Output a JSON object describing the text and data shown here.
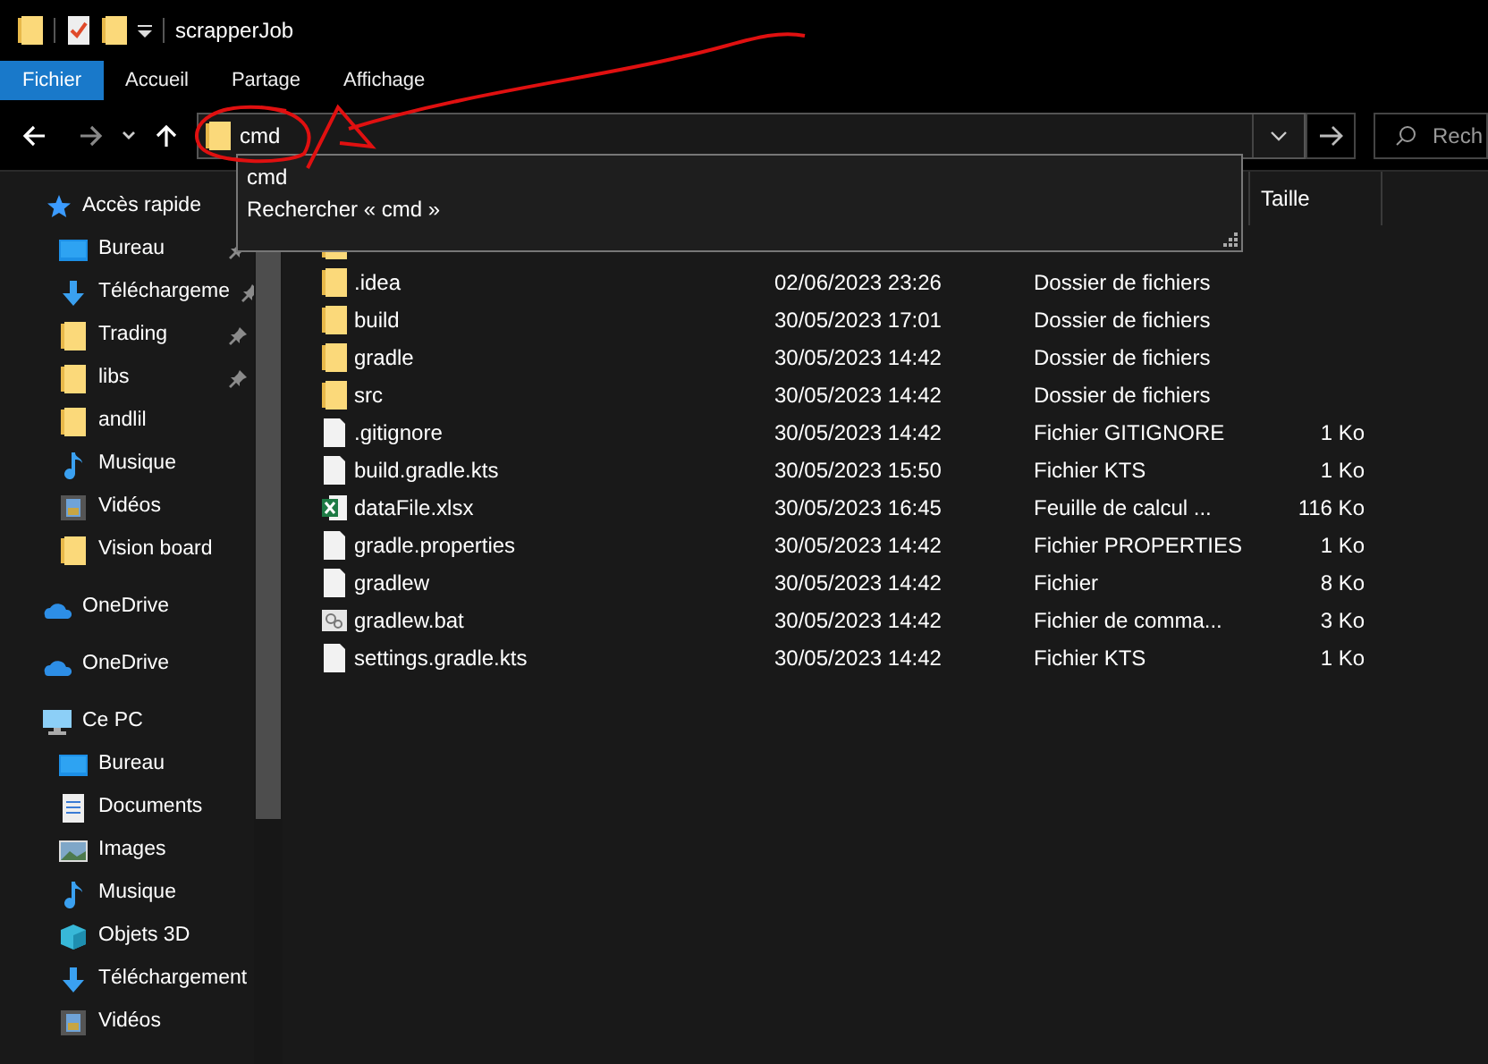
{
  "window": {
    "title": "scrapperJob"
  },
  "ribbon_tabs": [
    {
      "label": "Fichier",
      "selected": true
    },
    {
      "label": "Accueil",
      "selected": false
    },
    {
      "label": "Partage",
      "selected": false
    },
    {
      "label": "Affichage",
      "selected": false
    }
  ],
  "address": {
    "value": "cmd"
  },
  "search": {
    "placeholder": "Rech"
  },
  "suggestions": [
    "cmd",
    "Rechercher « cmd »"
  ],
  "sidebar": [
    {
      "kind": "star",
      "label": "Accès rapide",
      "children": [
        {
          "kind": "desktop",
          "label": "Bureau",
          "pinned": true
        },
        {
          "kind": "download",
          "label": "Téléchargeme",
          "pinned": true
        },
        {
          "kind": "folder",
          "label": "Trading",
          "pinned": true
        },
        {
          "kind": "folder",
          "label": "libs",
          "pinned": true
        },
        {
          "kind": "folder",
          "label": "andlil",
          "pinned": false
        },
        {
          "kind": "music",
          "label": "Musique",
          "pinned": false
        },
        {
          "kind": "video",
          "label": "Vidéos",
          "pinned": false
        },
        {
          "kind": "folder",
          "label": "Vision board",
          "pinned": false
        }
      ]
    },
    {
      "kind": "cloud",
      "label": "OneDrive"
    },
    {
      "kind": "cloud",
      "label": "OneDrive"
    },
    {
      "kind": "pc",
      "label": "Ce PC",
      "children": [
        {
          "kind": "desktop",
          "label": "Bureau"
        },
        {
          "kind": "document",
          "label": "Documents"
        },
        {
          "kind": "image",
          "label": "Images"
        },
        {
          "kind": "music",
          "label": "Musique"
        },
        {
          "kind": "cube",
          "label": "Objets 3D"
        },
        {
          "kind": "download",
          "label": "Téléchargement"
        },
        {
          "kind": "video",
          "label": "Vidéos"
        }
      ]
    }
  ],
  "table": {
    "columns": [
      "Taille"
    ],
    "rows": [
      {
        "kind": "folder",
        "name": ".idea",
        "modified": "02/06/2023 23:26",
        "type": "Dossier de fichiers",
        "size": ""
      },
      {
        "kind": "folder",
        "name": "build",
        "modified": "30/05/2023 17:01",
        "type": "Dossier de fichiers",
        "size": ""
      },
      {
        "kind": "folder",
        "name": "gradle",
        "modified": "30/05/2023 14:42",
        "type": "Dossier de fichiers",
        "size": ""
      },
      {
        "kind": "folder",
        "name": "src",
        "modified": "30/05/2023 14:42",
        "type": "Dossier de fichiers",
        "size": ""
      },
      {
        "kind": "file",
        "name": ".gitignore",
        "modified": "30/05/2023 14:42",
        "type": "Fichier GITIGNORE",
        "size": "1 Ko"
      },
      {
        "kind": "file",
        "name": "build.gradle.kts",
        "modified": "30/05/2023 15:50",
        "type": "Fichier KTS",
        "size": "1 Ko"
      },
      {
        "kind": "excel",
        "name": "dataFile.xlsx",
        "modified": "30/05/2023 16:45",
        "type": "Feuille de calcul ...",
        "size": "116 Ko"
      },
      {
        "kind": "file",
        "name": "gradle.properties",
        "modified": "30/05/2023 14:42",
        "type": "Fichier PROPERTIES",
        "size": "1 Ko"
      },
      {
        "kind": "file",
        "name": "gradlew",
        "modified": "30/05/2023 14:42",
        "type": "Fichier",
        "size": "8 Ko"
      },
      {
        "kind": "bat",
        "name": "gradlew.bat",
        "modified": "30/05/2023 14:42",
        "type": "Fichier de comma...",
        "size": "3 Ko"
      },
      {
        "kind": "file",
        "name": "settings.gradle.kts",
        "modified": "30/05/2023 14:42",
        "type": "Fichier KTS",
        "size": "1 Ko"
      }
    ]
  }
}
